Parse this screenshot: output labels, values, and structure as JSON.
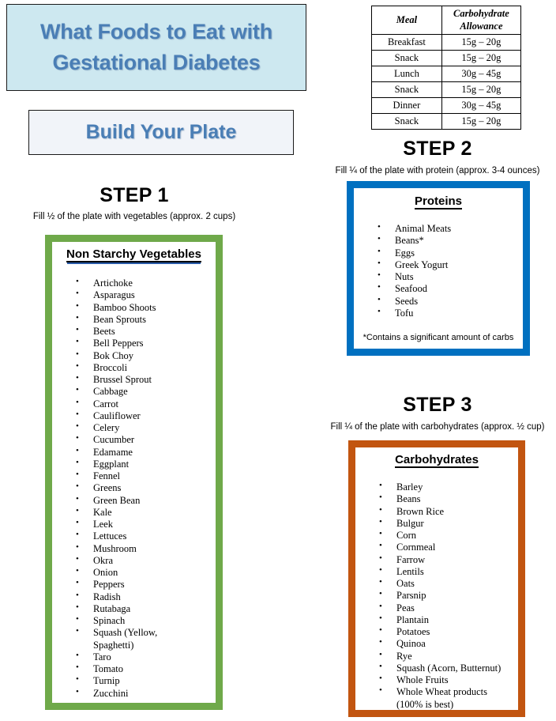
{
  "title": {
    "line1": "What Foods to Eat with",
    "line2": "Gestational Diabetes",
    "bg_color": "#CDE8F0",
    "text_color": "#4A7EB5"
  },
  "subtitle": {
    "label": "Build Your Plate",
    "bg_color": "#F1F4F9",
    "text_color": "#4A7EB5"
  },
  "carb_table": {
    "headers": [
      "Meal",
      "Carbohydrate Allowance"
    ],
    "header_meal": "Meal",
    "header_allowance_line1": "Carbohydrate",
    "header_allowance_line2": "Allowance",
    "rows": [
      {
        "meal": "Breakfast",
        "allowance": "15g – 20g"
      },
      {
        "meal": "Snack",
        "allowance": "15g – 20g"
      },
      {
        "meal": "Lunch",
        "allowance": "30g – 45g"
      },
      {
        "meal": "Snack",
        "allowance": "15g – 20g"
      },
      {
        "meal": "Dinner",
        "allowance": "30g – 45g"
      },
      {
        "meal": "Snack",
        "allowance": "15g – 20g"
      }
    ]
  },
  "step1": {
    "heading": "STEP 1",
    "caption": "Fill ½ of the plate with vegetables (approx. 2 cups)",
    "box_title": "Non Starchy Vegetables",
    "border_color": "#6FA94A",
    "items": [
      "Artichoke",
      "Asparagus",
      "Bamboo Shoots",
      "Bean Sprouts",
      "Beets",
      "Bell Peppers",
      "Bok Choy",
      "Broccoli",
      "Brussel Sprout",
      "Cabbage",
      "Carrot",
      "Cauliflower",
      "Celery",
      "Cucumber",
      "Edamame",
      "Eggplant",
      "Fennel",
      "Greens",
      "Green Bean",
      "Kale",
      "Leek",
      "Lettuces",
      "Mushroom",
      "Okra",
      "Onion",
      "Peppers",
      "Radish",
      "Rutabaga",
      "Spinach",
      "Squash (Yellow,",
      "Spaghetti)",
      "Taro",
      "Tomato",
      "Turnip",
      "Zucchini"
    ],
    "continuation_indices": [
      30
    ]
  },
  "step2": {
    "heading": "STEP 2",
    "caption": "Fill ¼ of the plate with protein (approx. 3-4 ounces)",
    "box_title": "Proteins",
    "border_color": "#0070C0",
    "items": [
      "Animal Meats",
      "Beans*",
      "Eggs",
      "Greek Yogurt",
      "Nuts",
      "Seafood",
      "Seeds",
      "Tofu"
    ],
    "footnote": "*Contains a significant amount of carbs"
  },
  "step3": {
    "heading": "STEP 3",
    "caption": "Fill ¼ of the plate with carbohydrates (approx. ½ cup)",
    "box_title": "Carbohydrates",
    "border_color": "#C25510",
    "items": [
      "Barley",
      "Beans",
      "Brown Rice",
      "Bulgur",
      "Corn",
      "Cornmeal",
      "Farrow",
      "Lentils",
      "Oats",
      "Parsnip",
      "Peas",
      "Plantain",
      "Potatoes",
      "Quinoa",
      "Rye",
      "Squash (Acorn, Butternut)",
      "Whole Fruits",
      "Whole Wheat products",
      "(100% is best)"
    ],
    "continuation_indices": [
      18
    ]
  }
}
